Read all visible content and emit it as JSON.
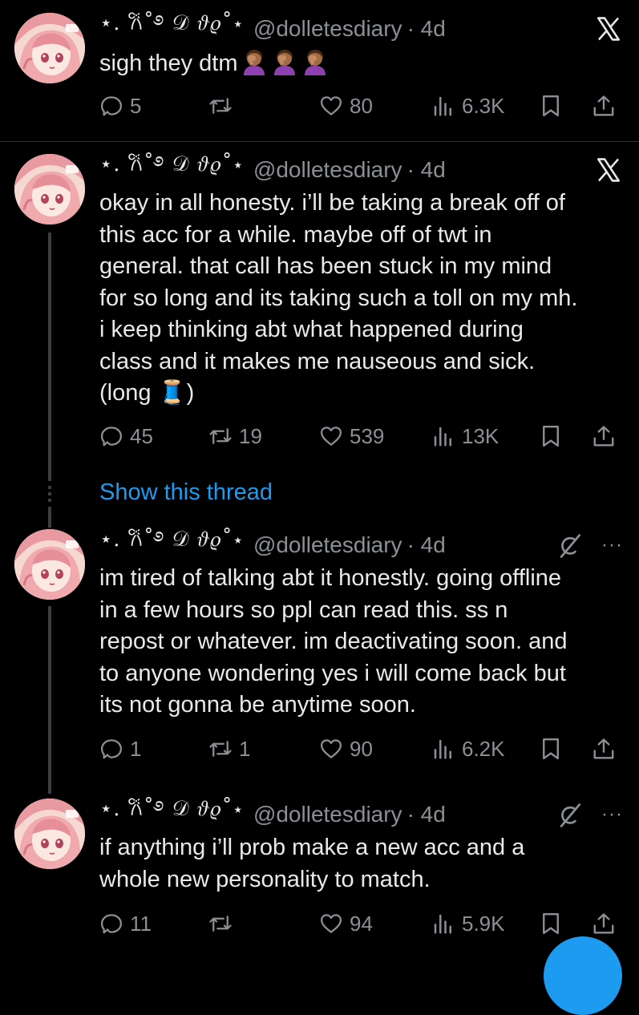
{
  "tweets": [
    {
      "display_name": "⋆. 𐙚˚࿔ 𝒟 𝜗𝜚˚⋆",
      "handle": "@dolletesdiary",
      "time": "· 4d",
      "text": "sigh they dtm",
      "emoji": "woman-facepalming",
      "corner_icon": "x-logo-icon",
      "replies": "5",
      "retweets": "",
      "likes": "80",
      "views": "6.3K"
    },
    {
      "display_name": "⋆. 𐙚˚࿔ 𝒟 𝜗𝜚˚⋆",
      "handle": "@dolletesdiary",
      "time": "· 4d",
      "text": "okay in all honesty. i’ll be taking a break off of\nthis acc for a while. maybe off of twt in\ngeneral. that call has been stuck in my mind\nfor so long and its taking such a toll on my mh.\ni keep thinking abt what happened during\nclass and it makes me nauseous and sick.\n(long 🧵)",
      "corner_icon": "x-logo-icon",
      "replies": "45",
      "retweets": "19",
      "likes": "539",
      "views": "13K"
    },
    {
      "display_name": "⋆. 𐙚˚࿔ 𝒟 𝜗𝜚˚⋆",
      "handle": "@dolletesdiary",
      "time": "· 4d",
      "text": "im tired of talking abt it honestly. going offline\nin a few hours so ppl can read this. ss n\nrepost or whatever. im deactivating soon. and\nto anyone wondering yes i will come back but\nits not gonna be anytime soon.",
      "corner_icon": "grok-icon",
      "more": "···",
      "replies": "1",
      "retweets": "1",
      "likes": "90",
      "views": "6.2K"
    },
    {
      "display_name": "⋆. 𐙚˚࿔ 𝒟 𝜗𝜚˚⋆",
      "handle": "@dolletesdiary",
      "time": "· 4d",
      "text": "if anything i’ll prob make a new acc and a\nwhole new personality to match.",
      "corner_icon": "grok-icon",
      "more": "···",
      "replies": "11",
      "retweets": "",
      "likes": "94",
      "views": "5.9K"
    }
  ],
  "show_thread": "Show this thread",
  "colors": {
    "background": "#000000",
    "text": "#e7e9ea",
    "muted": "#8b9095",
    "accent": "#1d9bf0"
  }
}
